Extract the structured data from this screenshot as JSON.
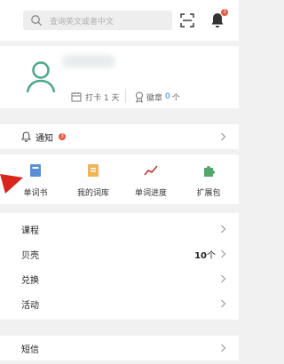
{
  "search": {
    "placeholder": "查询英文或者中文"
  },
  "notifications": {
    "badge_count": "3"
  },
  "profile": {
    "checkin_label": "打卡 1 天",
    "badge_label": "徽章",
    "badge_count": "0",
    "badge_unit": "个"
  },
  "notice": {
    "label": "通知",
    "count": "3"
  },
  "features": [
    {
      "label": "单词书",
      "icon": "wordbook-icon",
      "color": "#5a8fd8"
    },
    {
      "label": "我的词库",
      "icon": "my-vocab-icon",
      "color": "#f0b35a"
    },
    {
      "label": "单词进度",
      "icon": "progress-icon",
      "color": "#c0392b"
    },
    {
      "label": "扩展包",
      "icon": "puzzle-icon",
      "color": "#56a66b"
    }
  ],
  "menu": [
    {
      "label": "课程"
    },
    {
      "label": "贝壳",
      "value": "10",
      "unit": "个"
    },
    {
      "label": "兑换"
    },
    {
      "label": "活动"
    }
  ],
  "sms": {
    "label": "短信"
  },
  "colors": {
    "accent": "#4aa88a",
    "link": "#2d7be5",
    "badge_red": "#e9573f"
  }
}
